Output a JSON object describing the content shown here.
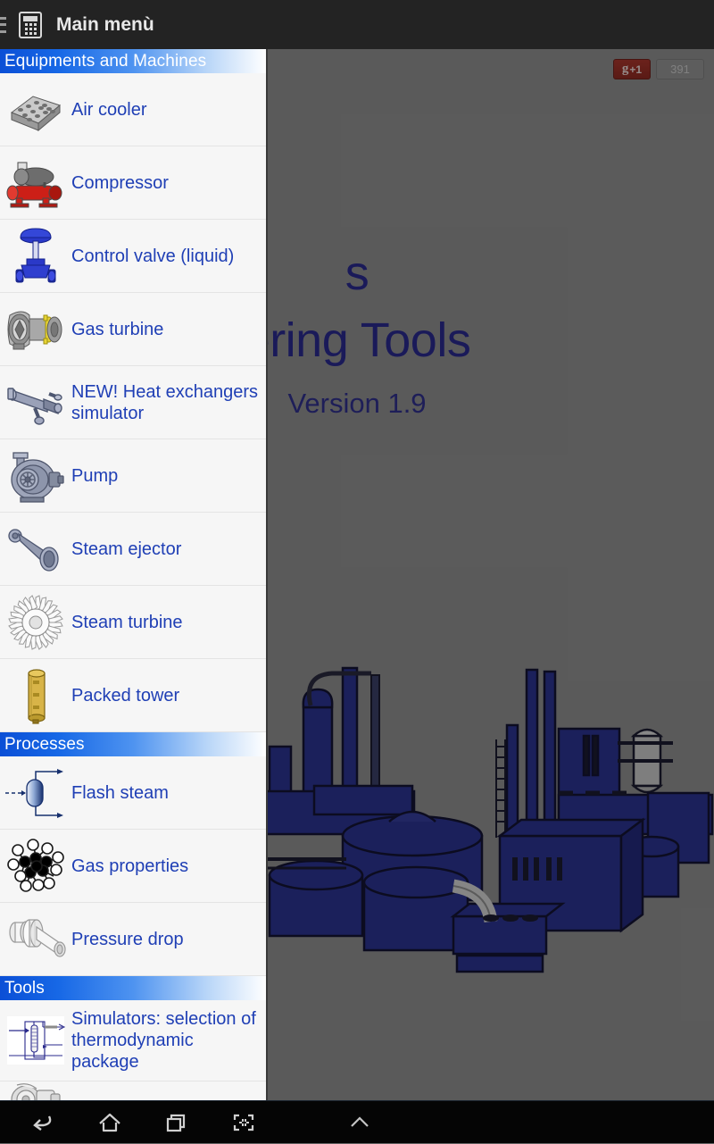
{
  "topbar": {
    "title": "Main menù",
    "app_icon": "calculator-icon",
    "drawer_indicator": "hamburger-icon"
  },
  "background": {
    "title_line1": "s",
    "title_line2": "ering Tools",
    "version": "Version 1.9",
    "illustration": "industrial-plant-illustration",
    "title_color": "#2a2a8c",
    "scrim_color": "#8e8e8e"
  },
  "google_plus": {
    "label": "+1",
    "glyph": "g",
    "count": "391",
    "button_color": "#a8352c"
  },
  "drawer": {
    "accent_color": "#0b4fd6",
    "link_color": "#1f3fb5",
    "sections": [
      {
        "header": "Equipments and Machines",
        "items": [
          {
            "label": "Air cooler",
            "icon": "air-cooler-icon"
          },
          {
            "label": "Compressor",
            "icon": "compressor-icon"
          },
          {
            "label": "Control valve (liquid)",
            "icon": "control-valve-icon"
          },
          {
            "label": "Gas turbine",
            "icon": "gas-turbine-icon"
          },
          {
            "label": "NEW! Heat exchangers simulator",
            "icon": "heat-exchanger-icon"
          },
          {
            "label": "Pump",
            "icon": "pump-icon"
          },
          {
            "label": "Steam ejector",
            "icon": "steam-ejector-icon"
          },
          {
            "label": "Steam turbine",
            "icon": "steam-turbine-icon"
          },
          {
            "label": "Packed tower",
            "icon": "packed-tower-icon"
          }
        ]
      },
      {
        "header": "Processes",
        "items": [
          {
            "label": "Flash steam",
            "icon": "flash-vessel-icon"
          },
          {
            "label": "Gas properties",
            "icon": "molecule-icon"
          },
          {
            "label": "Pressure drop",
            "icon": "pipe-fitting-icon"
          }
        ]
      },
      {
        "header": "Tools",
        "items": [
          {
            "label": "Simulators: selection of thermodynamic package",
            "icon": "distillation-flowsheet-icon"
          },
          {
            "label": "",
            "icon": "unit-converter-icon"
          }
        ]
      }
    ]
  },
  "navbar": {
    "buttons": [
      {
        "name": "back",
        "icon": "back-arrow-icon"
      },
      {
        "name": "home",
        "icon": "home-icon"
      },
      {
        "name": "recents",
        "icon": "recents-icon"
      },
      {
        "name": "screenshot",
        "icon": "screenshot-icon"
      },
      {
        "name": "expand",
        "icon": "chevron-up-icon"
      }
    ]
  }
}
